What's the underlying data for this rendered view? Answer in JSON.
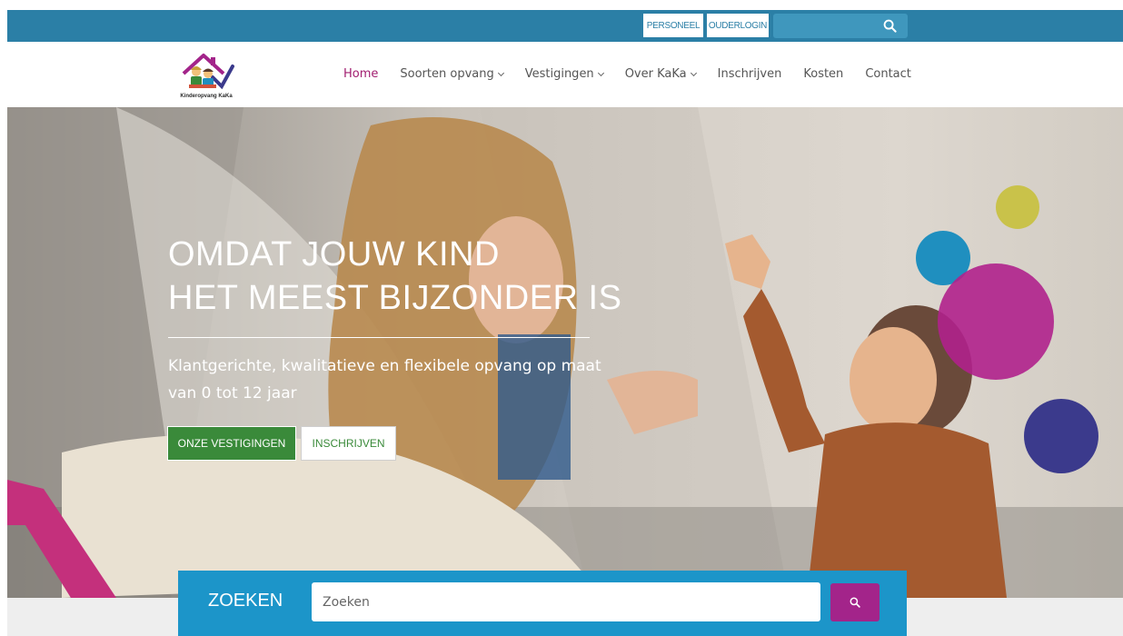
{
  "topbar": {
    "personeel_label": "PERSONEEL",
    "ouderlogin_label": "OUDERLOGIN",
    "search_icon": "search-icon"
  },
  "navbar": {
    "logo_text": "Kinderopvang KaKa",
    "items": [
      {
        "label": "Home",
        "active": true,
        "dropdown": false
      },
      {
        "label": "Soorten opvang",
        "active": false,
        "dropdown": true
      },
      {
        "label": "Vestigingen",
        "active": false,
        "dropdown": true
      },
      {
        "label": "Over KaKa",
        "active": false,
        "dropdown": true
      },
      {
        "label": "Inschrijven",
        "active": false,
        "dropdown": false
      },
      {
        "label": "Kosten",
        "active": false,
        "dropdown": false
      },
      {
        "label": "Contact",
        "active": false,
        "dropdown": false
      }
    ]
  },
  "hero": {
    "title_line1": "OMDAT JOUW KIND",
    "title_line2": "HET MEEST BIJZONDER IS",
    "subtitle": "Klantgerichte, kwalitatieve en flexibele opvang op maat van 0 tot 12 jaar",
    "btn_vestigingen": "ONZE VESTIGINGEN",
    "btn_inschrijven": "INSCHRIJVEN"
  },
  "search_panel": {
    "label": "ZOEKEN",
    "placeholder": "Zoeken",
    "search_icon": "search-icon"
  },
  "colors": {
    "topbar": "#2b7fa6",
    "nav_active": "#a11d6f",
    "btn_green": "#3a8a3a",
    "search_panel": "#1c95c9",
    "search_button": "#a3248a",
    "circle_yellow": "#c9c24a",
    "circle_blue": "#1f8fbf",
    "circle_magenta": "#b0218c",
    "circle_indigo": "#3b3a8c"
  }
}
